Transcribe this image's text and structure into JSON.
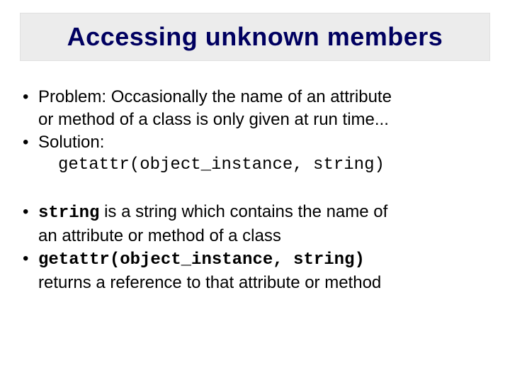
{
  "title": "Accessing unknown members",
  "group1": {
    "b1_line1": "Problem:  Occasionally  the name of an attribute",
    "b1_line2": "or method of a class is only given at run time...",
    "b2": "Solution:",
    "b2_code": "getattr(object_instance, string)"
  },
  "group2": {
    "b3_code": "string",
    "b3_rest1": " is a string which contains the name of",
    "b3_line2": "an attribute or method of a class",
    "b4_code": "getattr(object_instance, string)",
    "b4_line2": "returns a reference to that attribute or method"
  }
}
